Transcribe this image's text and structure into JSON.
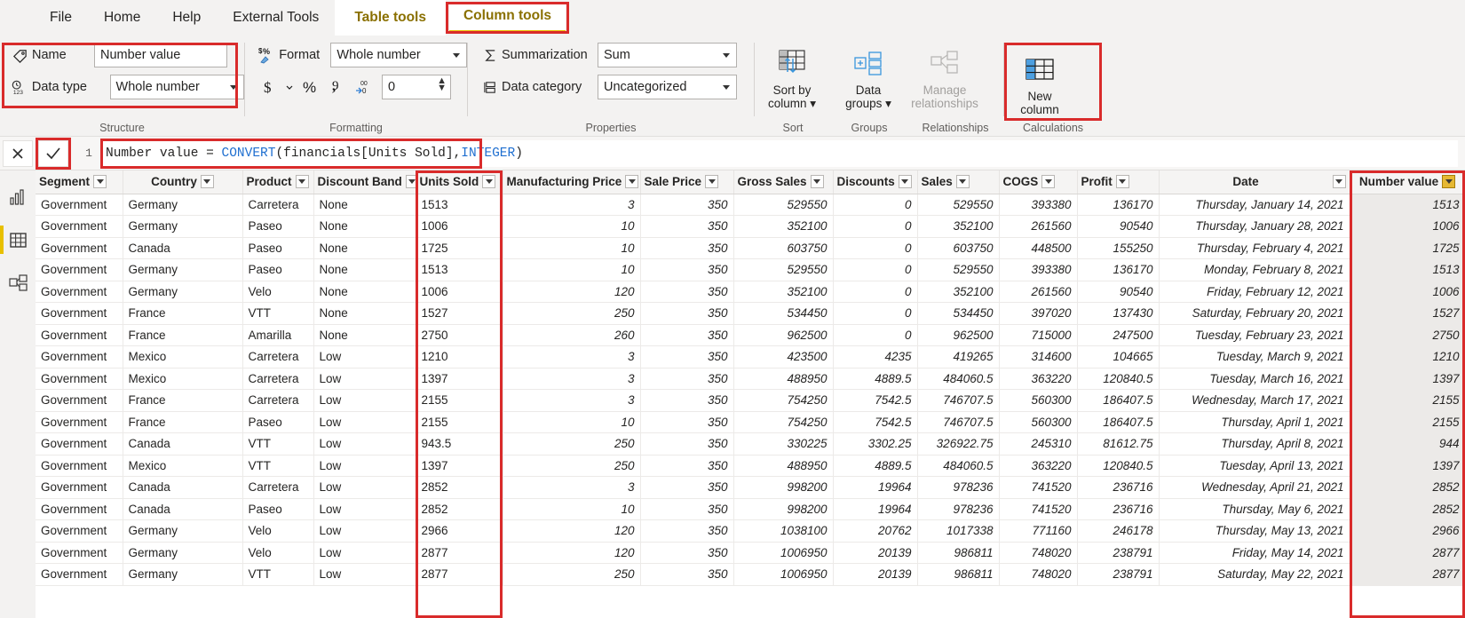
{
  "ribbon": {
    "tabs": [
      {
        "label": "File",
        "active": false
      },
      {
        "label": "Home",
        "active": false
      },
      {
        "label": "Help",
        "active": false
      },
      {
        "label": "External Tools",
        "active": false
      },
      {
        "label": "Table tools",
        "active": false
      },
      {
        "label": "Column tools",
        "active": true
      }
    ],
    "structure": {
      "group_label": "Structure",
      "name_label": "Name",
      "name_value": "Number value",
      "name_icon": "tag-icon",
      "datatype_label": "Data type",
      "datatype_value": "Whole number",
      "datatype_icon": "number-type-icon"
    },
    "formatting": {
      "group_label": "Formatting",
      "format_label": "Format",
      "format_value": "Whole number",
      "format_icon": "format-paint-icon",
      "currency_icon": "dollar-sign-icon",
      "currency_caret_icon": "chevron-down-icon",
      "percent_icon": "percent-icon",
      "thousands_icon": "comma-separator-icon",
      "decimal_icon": "decrease-decimals-icon",
      "decimal_places_value": "0",
      "spinner_up_icon": "chevron-up-icon",
      "spinner_down_icon": "chevron-down-icon"
    },
    "properties": {
      "group_label": "Properties",
      "summarization_label": "Summarization",
      "summarization_value": "Sum",
      "summarization_icon": "sigma-icon",
      "datacategory_label": "Data category",
      "datacategory_value": "Uncategorized",
      "datacategory_icon": "data-category-icon"
    },
    "sort": {
      "group_label": "Sort",
      "button_line1": "Sort by",
      "button_line2": "column",
      "icon": "sort-by-column-icon"
    },
    "groups": {
      "group_label": "Groups",
      "button_line1": "Data",
      "button_line2": "groups",
      "icon": "data-groups-icon"
    },
    "relationships": {
      "group_label": "Relationships",
      "button_line1": "Manage",
      "button_line2": "relationships",
      "icon": "manage-relationships-icon"
    },
    "calculations": {
      "group_label": "Calculations",
      "button_line1": "New",
      "button_line2": "column",
      "icon": "new-column-icon"
    }
  },
  "formula_bar": {
    "cancel_icon": "close-x-icon",
    "commit_icon": "checkmark-icon",
    "line_number": "1",
    "expr_prefix": "Number value = ",
    "expr_fn": "CONVERT",
    "expr_mid": "(financials[Units Sold],",
    "expr_kw": "INTEGER",
    "expr_suffix": ")",
    "full_expression": "Number value = CONVERT(financials[Units Sold],INTEGER)"
  },
  "leftnav": {
    "items": [
      {
        "name": "report-view",
        "icon": "bar-chart-icon",
        "active": false
      },
      {
        "name": "data-view",
        "icon": "table-grid-icon",
        "active": true
      },
      {
        "name": "model-view",
        "icon": "model-relationships-icon",
        "active": false
      }
    ]
  },
  "table": {
    "columns": [
      {
        "label": "Segment",
        "align": "left",
        "type": "txt"
      },
      {
        "label": "Country",
        "align": "left",
        "type": "txt"
      },
      {
        "label": "Product",
        "align": "left",
        "type": "txt"
      },
      {
        "label": "Discount Band",
        "align": "left",
        "type": "txt"
      },
      {
        "label": "Units Sold",
        "align": "left",
        "type": "units"
      },
      {
        "label": "Manufacturing Price",
        "align": "right",
        "type": "num"
      },
      {
        "label": "Sale Price",
        "align": "right",
        "type": "num"
      },
      {
        "label": "Gross Sales",
        "align": "right",
        "type": "num"
      },
      {
        "label": "Discounts",
        "align": "right",
        "type": "num"
      },
      {
        "label": "Sales",
        "align": "right",
        "type": "num"
      },
      {
        "label": "COGS",
        "align": "right",
        "type": "num"
      },
      {
        "label": "Profit",
        "align": "right",
        "type": "num"
      },
      {
        "label": "Date",
        "align": "right",
        "type": "date"
      },
      {
        "label": "Number value",
        "align": "right",
        "type": "numvalue"
      }
    ],
    "rows": [
      [
        "Government",
        "Germany",
        "Carretera",
        "None",
        "1513",
        "3",
        "350",
        "529550",
        "0",
        "529550",
        "393380",
        "136170",
        "Thursday, January 14, 2021",
        "1513"
      ],
      [
        "Government",
        "Germany",
        "Paseo",
        "None",
        "1006",
        "10",
        "350",
        "352100",
        "0",
        "352100",
        "261560",
        "90540",
        "Thursday, January 28, 2021",
        "1006"
      ],
      [
        "Government",
        "Canada",
        "Paseo",
        "None",
        "1725",
        "10",
        "350",
        "603750",
        "0",
        "603750",
        "448500",
        "155250",
        "Thursday, February 4, 2021",
        "1725"
      ],
      [
        "Government",
        "Germany",
        "Paseo",
        "None",
        "1513",
        "10",
        "350",
        "529550",
        "0",
        "529550",
        "393380",
        "136170",
        "Monday, February 8, 2021",
        "1513"
      ],
      [
        "Government",
        "Germany",
        "Velo",
        "None",
        "1006",
        "120",
        "350",
        "352100",
        "0",
        "352100",
        "261560",
        "90540",
        "Friday, February 12, 2021",
        "1006"
      ],
      [
        "Government",
        "France",
        "VTT",
        "None",
        "1527",
        "250",
        "350",
        "534450",
        "0",
        "534450",
        "397020",
        "137430",
        "Saturday, February 20, 2021",
        "1527"
      ],
      [
        "Government",
        "France",
        "Amarilla",
        "None",
        "2750",
        "260",
        "350",
        "962500",
        "0",
        "962500",
        "715000",
        "247500",
        "Tuesday, February 23, 2021",
        "2750"
      ],
      [
        "Government",
        "Mexico",
        "Carretera",
        "Low",
        "1210",
        "3",
        "350",
        "423500",
        "4235",
        "419265",
        "314600",
        "104665",
        "Tuesday, March 9, 2021",
        "1210"
      ],
      [
        "Government",
        "Mexico",
        "Carretera",
        "Low",
        "1397",
        "3",
        "350",
        "488950",
        "4889.5",
        "484060.5",
        "363220",
        "120840.5",
        "Tuesday, March 16, 2021",
        "1397"
      ],
      [
        "Government",
        "France",
        "Carretera",
        "Low",
        "2155",
        "3",
        "350",
        "754250",
        "7542.5",
        "746707.5",
        "560300",
        "186407.5",
        "Wednesday, March 17, 2021",
        "2155"
      ],
      [
        "Government",
        "France",
        "Paseo",
        "Low",
        "2155",
        "10",
        "350",
        "754250",
        "7542.5",
        "746707.5",
        "560300",
        "186407.5",
        "Thursday, April 1, 2021",
        "2155"
      ],
      [
        "Government",
        "Canada",
        "VTT",
        "Low",
        "943.5",
        "250",
        "350",
        "330225",
        "3302.25",
        "326922.75",
        "245310",
        "81612.75",
        "Thursday, April 8, 2021",
        "944"
      ],
      [
        "Government",
        "Mexico",
        "VTT",
        "Low",
        "1397",
        "250",
        "350",
        "488950",
        "4889.5",
        "484060.5",
        "363220",
        "120840.5",
        "Tuesday, April 13, 2021",
        "1397"
      ],
      [
        "Government",
        "Canada",
        "Carretera",
        "Low",
        "2852",
        "3",
        "350",
        "998200",
        "19964",
        "978236",
        "741520",
        "236716",
        "Wednesday, April 21, 2021",
        "2852"
      ],
      [
        "Government",
        "Canada",
        "Paseo",
        "Low",
        "2852",
        "10",
        "350",
        "998200",
        "19964",
        "978236",
        "741520",
        "236716",
        "Thursday, May 6, 2021",
        "2852"
      ],
      [
        "Government",
        "Germany",
        "Velo",
        "Low",
        "2966",
        "120",
        "350",
        "1038100",
        "20762",
        "1017338",
        "771160",
        "246178",
        "Thursday, May 13, 2021",
        "2966"
      ],
      [
        "Government",
        "Germany",
        "Velo",
        "Low",
        "2877",
        "120",
        "350",
        "1006950",
        "20139",
        "986811",
        "748020",
        "238791",
        "Friday, May 14, 2021",
        "2877"
      ],
      [
        "Government",
        "Germany",
        "VTT",
        "Low",
        "2877",
        "250",
        "350",
        "1006950",
        "20139",
        "986811",
        "748020",
        "238791",
        "Saturday, May 22, 2021",
        "2877"
      ]
    ]
  },
  "colors": {
    "highlight_red": "#d92b2b",
    "tab_gold": "#8a7000",
    "header_gold": "#d9a40c",
    "accent_yellow": "#e8c000"
  }
}
